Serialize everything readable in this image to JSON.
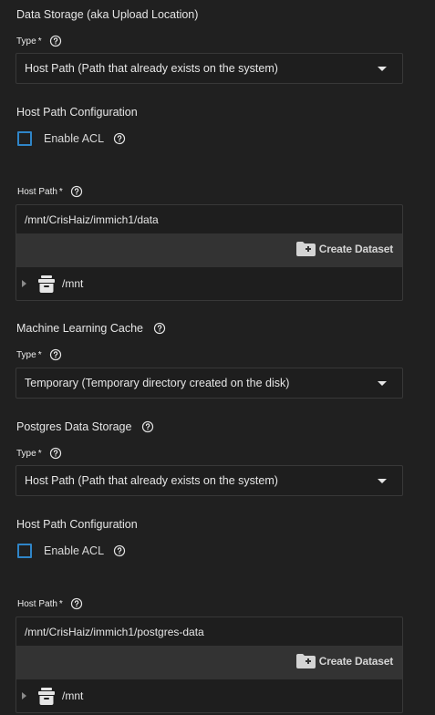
{
  "data_storage": {
    "title": "Data Storage (aka Upload Location)",
    "type_label": "Type",
    "required_mark": "*",
    "type_value": "Host Path (Path that already exists on the system)",
    "config_title": "Host Path Configuration",
    "acl_label": "Enable ACL",
    "host_path_label": "Host Path",
    "host_path_value": "/mnt/CrisHaiz/immich1/data",
    "create_dataset_label": "Create Dataset",
    "tree_root": "/mnt"
  },
  "ml_cache": {
    "title": "Machine Learning Cache",
    "type_label": "Type",
    "required_mark": "*",
    "type_value": "Temporary (Temporary directory created on the disk)"
  },
  "postgres": {
    "title": "Postgres Data Storage",
    "type_label": "Type",
    "required_mark": "*",
    "type_value": "Host Path (Path that already exists on the system)",
    "config_title": "Host Path Configuration",
    "acl_label": "Enable ACL",
    "host_path_label": "Host Path",
    "host_path_value": "/mnt/CrisHaiz/immich1/postgres-data",
    "create_dataset_label": "Create Dataset",
    "tree_root": "/mnt"
  },
  "icons": {
    "help": "help-circle-icon",
    "dropdown": "caret-down-icon",
    "create_dataset": "folder-plus-icon",
    "tree_toggle": "chevron-right-icon",
    "dataset": "disk-icon"
  },
  "colors": {
    "background": "#202020",
    "checkbox_border": "#2f85c8",
    "toolbar": "#333333",
    "field_border": "#383838"
  }
}
